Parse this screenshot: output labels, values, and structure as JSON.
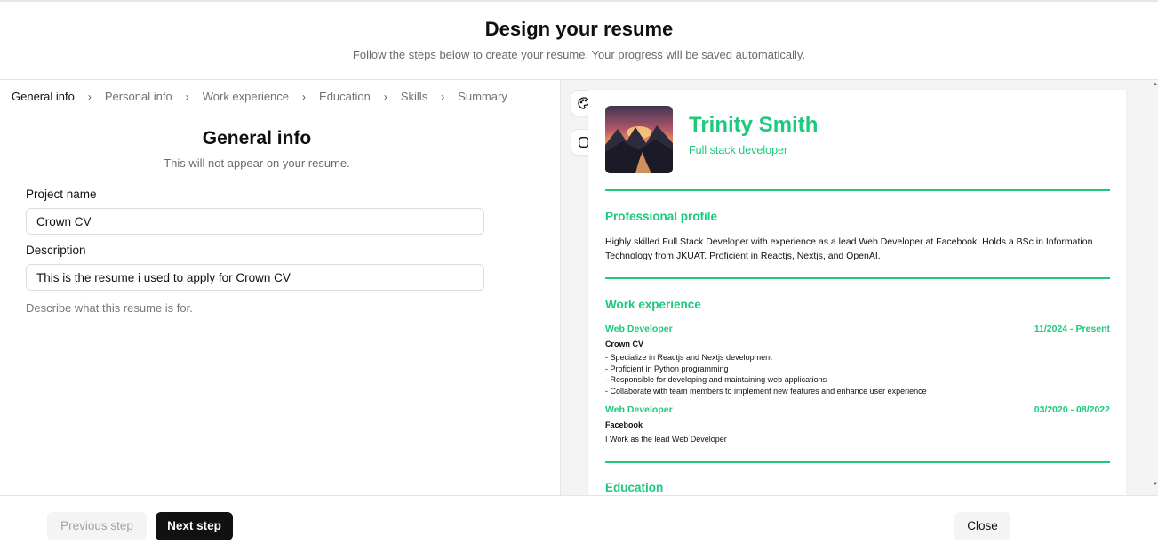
{
  "header": {
    "title": "Design your resume",
    "subtitle": "Follow the steps below to create your resume. Your progress will be saved automatically."
  },
  "breadcrumbs": [
    "General info",
    "Personal info",
    "Work experience",
    "Education",
    "Skills",
    "Summary"
  ],
  "form": {
    "title": "General info",
    "subtitle": "This will not appear on your resume.",
    "project_name_label": "Project name",
    "project_name_value": "Crown CV",
    "description_label": "Description",
    "description_value": "This is the resume i used to apply for Crown CV",
    "description_hint": "Describe what this resume is for."
  },
  "preview": {
    "toolbar": {
      "color_tool_icon": "palette-icon",
      "border_tool_icon": "square-rounded-icon"
    },
    "name": "Trinity Smith",
    "job_title": "Full stack developer",
    "accent_color": "#1ec97e",
    "profile_heading": "Professional profile",
    "profile_text": "Highly skilled Full Stack Developer with experience as a lead Web Developer at Facebook. Holds a BSc in Information Technology from JKUAT. Proficient in Reactjs, Nextjs, and OpenAI.",
    "work_heading": "Work experience",
    "jobs": [
      {
        "role": "Web Developer",
        "dates": "11/2024 - Present",
        "company": "Crown CV",
        "lines": [
          "- Specialize in Reactjs and Nextjs development",
          "- Proficient in Python programming",
          "- Responsible for developing and maintaining web applications",
          "- Collaborate with team members to implement new features and enhance user experience"
        ]
      },
      {
        "role": "Web Developer",
        "dates": "03/2020 - 08/2022",
        "company": "Facebook",
        "lines": [
          "I Work as the lead Web Developer"
        ]
      }
    ],
    "education_heading": "Education"
  },
  "footer": {
    "previous_label": "Previous step",
    "next_label": "Next step",
    "close_label": "Close"
  }
}
